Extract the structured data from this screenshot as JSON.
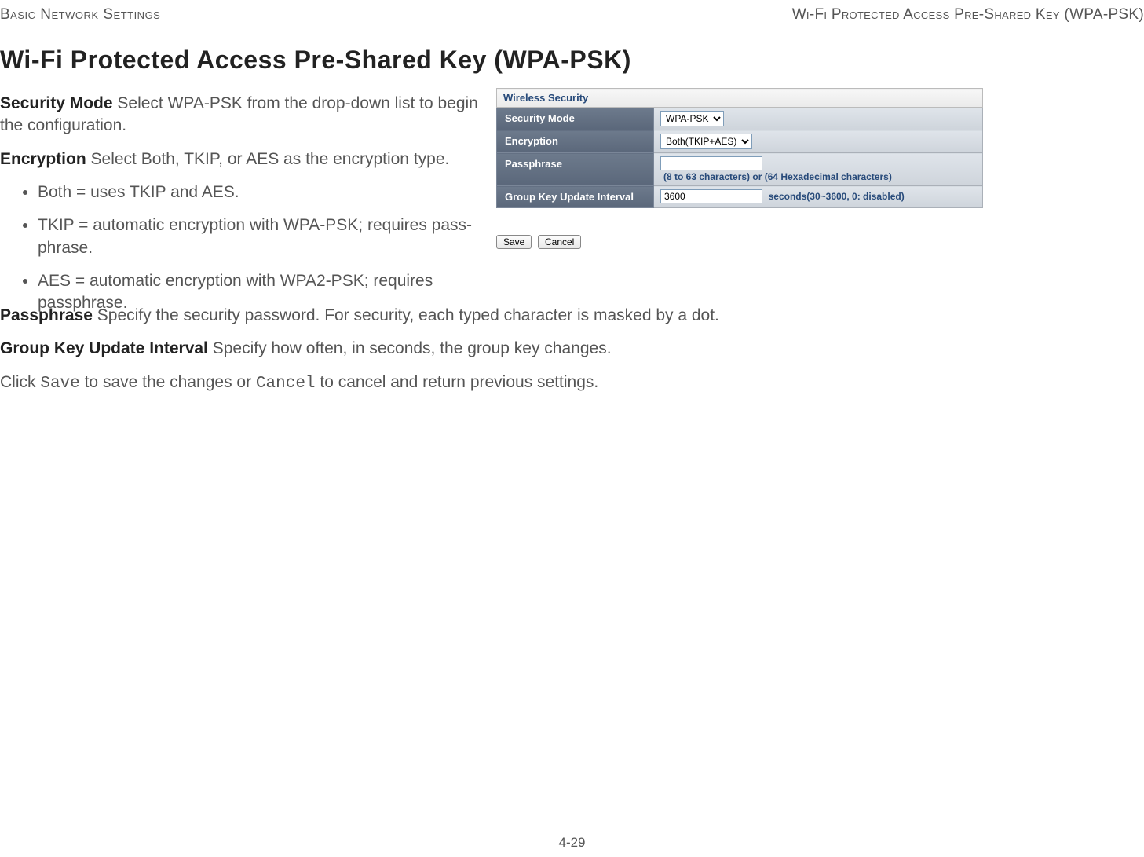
{
  "header": {
    "left": "Basic Network Settings",
    "right": "Wi-Fi Protected Access Pre-Shared Key (WPA-PSK)"
  },
  "heading": "Wi-Fi Protected Access Pre-Shared Key (WPA-PSK)",
  "paragraphs": {
    "security_mode_label": "Security Mode",
    "security_mode_text": "  Select WPA-PSK from the drop-down list to begin the configuration.",
    "encryption_label": "Encryption",
    "encryption_text": "  Select Both, TKIP, or AES as the encryption type.",
    "bullets": [
      "Both = uses TKIP and AES.",
      "TKIP = automatic encryption with WPA-PSK; requires pass-phrase.",
      "AES = automatic encryption with WPA2-PSK; requires passphrase."
    ],
    "passphrase_label": "Passphrase",
    "passphrase_text": "  Specify the security password. For security, each typed character is masked by a dot.",
    "gkui_label": "Group Key Update Interval",
    "gkui_text": "  Specify how often, in seconds, the group key changes.",
    "click_prefix": "Click ",
    "save_mono": "Save",
    "click_mid": " to save the changes or ",
    "cancel_mono": "Cancel",
    "click_suffix": " to cancel and return previous settings."
  },
  "ui": {
    "section_title": "Wireless Security",
    "rows": {
      "security_mode": {
        "label": "Security Mode",
        "value": "WPA-PSK"
      },
      "encryption": {
        "label": "Encryption",
        "value": "Both(TKIP+AES)"
      },
      "passphrase": {
        "label": "Passphrase",
        "value": "",
        "hint": "(8 to 63 characters) or (64 Hexadecimal characters)"
      },
      "gkui": {
        "label": "Group Key Update Interval",
        "value": "3600",
        "hint": "seconds(30~3600, 0: disabled)"
      }
    },
    "buttons": {
      "save": "Save",
      "cancel": "Cancel"
    }
  },
  "page_number": "4-29"
}
